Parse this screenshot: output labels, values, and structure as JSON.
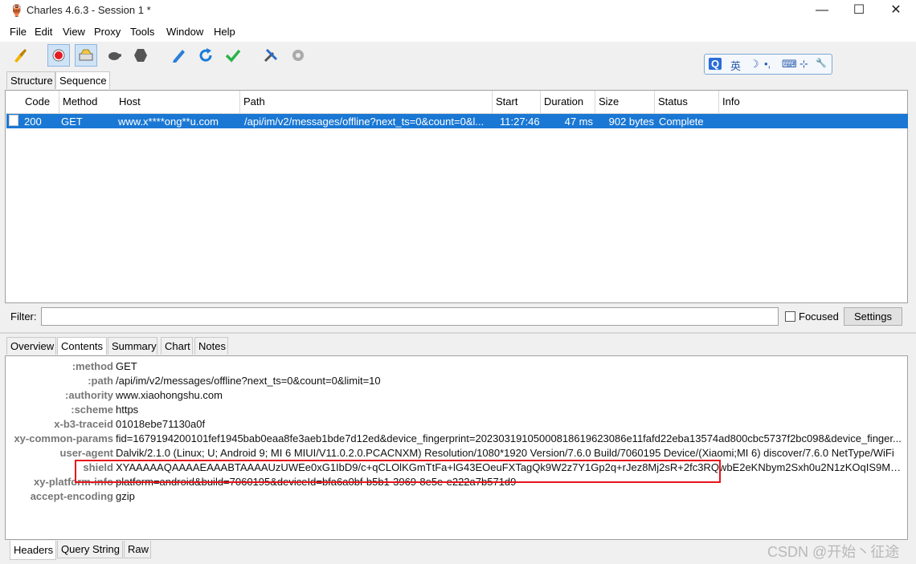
{
  "window": {
    "title": "Charles 4.6.3 - Session 1 *",
    "minimize": "—",
    "maximize": "☐",
    "close": "✕"
  },
  "menu": [
    "File",
    "Edit",
    "View",
    "Proxy",
    "Tools",
    "Window",
    "Help"
  ],
  "ime": {
    "logo": "Q",
    "lang": "英",
    "moon": "☽",
    "punct": "•,",
    "keyboard": "⌨",
    "settings": "⊹",
    "wrench": "🔧"
  },
  "top_tabs": [
    "Structure",
    "Sequence"
  ],
  "columns": [
    "Code",
    "Method",
    "Host",
    "Path",
    "Start",
    "Duration",
    "Size",
    "Status",
    "Info"
  ],
  "row": {
    "code": "200",
    "method": "GET",
    "host": "www.x****ong**u.com",
    "path": "/api/im/v2/messages/offline?next_ts=0&count=0&l...",
    "start": "11:27:46",
    "duration": "47 ms",
    "size": "902 bytes",
    "status": "Complete",
    "info": ""
  },
  "filter": {
    "label": "Filter:",
    "value": "",
    "focused_label": "Focused",
    "settings_label": "Settings"
  },
  "detail_tabs": [
    "Overview",
    "Contents",
    "Summary",
    "Chart",
    "Notes"
  ],
  "headers": [
    {
      "k": ":method",
      "v": "GET"
    },
    {
      "k": ":path",
      "v": "/api/im/v2/messages/offline?next_ts=0&count=0&limit=10"
    },
    {
      "k": ":authority",
      "v": "www.xiaohongshu.com"
    },
    {
      "k": ":scheme",
      "v": "https"
    },
    {
      "k": "x-b3-traceid",
      "v": "01018ebe71130a0f"
    },
    {
      "k": "xy-common-params",
      "v": "fid=1679194200101fef1945bab0eaa8fe3aeb1bde7d12ed&device_fingerprint=20230319105000818619623086e11fafd22eba13574ad800cbc5737f2bc098&device_finger..."
    },
    {
      "k": "user-agent",
      "v": "Dalvik/2.1.0 (Linux; U; Android 9; MI 6 MIUI/V11.0.2.0.PCACNXM) Resolution/1080*1920 Version/7.6.0 Build/7060195 Device/(Xiaomi;MI 6) discover/7.6.0 NetType/WiFi"
    },
    {
      "k": "shield",
      "v": "XYAAAAAQAAAAEAAABTAAAAUzUWEe0xG1IbD9/c+qCLOlKGmTtFa+lG43EOeuFXTagQk9W2z7Y1Gp2q+rJez8Mj2sR+2fc3RQwbE2eKNbym2Sxh0u2N1zKOqIS9MUSW7e..."
    },
    {
      "k": "xy-platform-info",
      "v": "platform=android&build=7060195&deviceId=bfa6a0bf-b5b1-3969-8e5e-e222a7b571d9"
    },
    {
      "k": "accept-encoding",
      "v": "gzip"
    }
  ],
  "bottom_tabs": [
    "Headers",
    "Query String",
    "Raw"
  ],
  "watermark": "CSDN @开始丶征途"
}
